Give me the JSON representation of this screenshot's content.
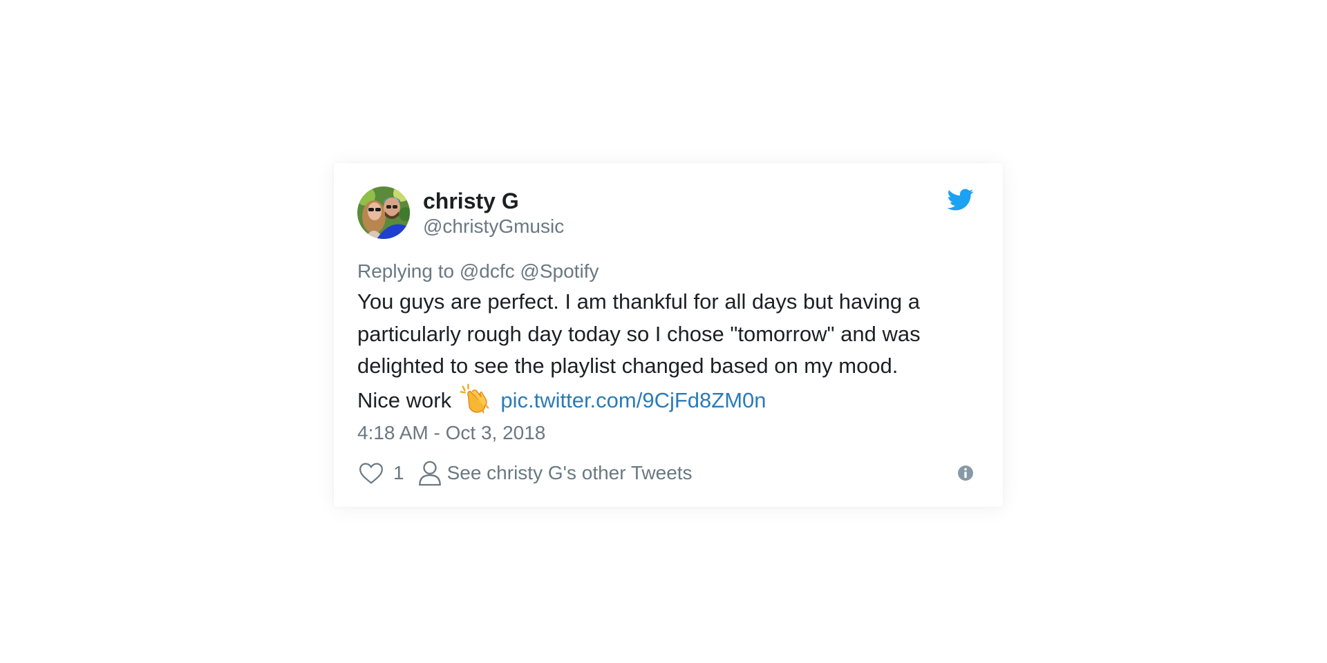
{
  "tweet": {
    "author": {
      "display_name": "christy G",
      "handle": "@christyGmusic",
      "avatar": "avatar-photo"
    },
    "reply_prefix": "Replying to",
    "reply_mentions": "@dcfc @Spotify",
    "text_lines": [
      "You guys are perfect. I am thankful for all days but having a",
      "particularly rough day today so I chose \"tomorrow\" and was",
      "delighted to see the playlist changed based on my mood.",
      "Nice work"
    ],
    "emoji": "clapping-hands-emoji",
    "link": "pic.twitter.com/9CjFd8ZM0n",
    "timestamp": "4:18 AM - Oct 3, 2018",
    "like_count": "1",
    "other_tweets_label": "See christy G's other Tweets"
  },
  "icons": {
    "brand": "twitter-bird-icon",
    "like": "heart-icon",
    "profile": "person-icon",
    "info": "info-icon"
  },
  "colors": {
    "text": "#1c2022",
    "secondary_text": "#697882",
    "link": "#2b7bb9",
    "twitter_blue": "#1da1f2"
  }
}
